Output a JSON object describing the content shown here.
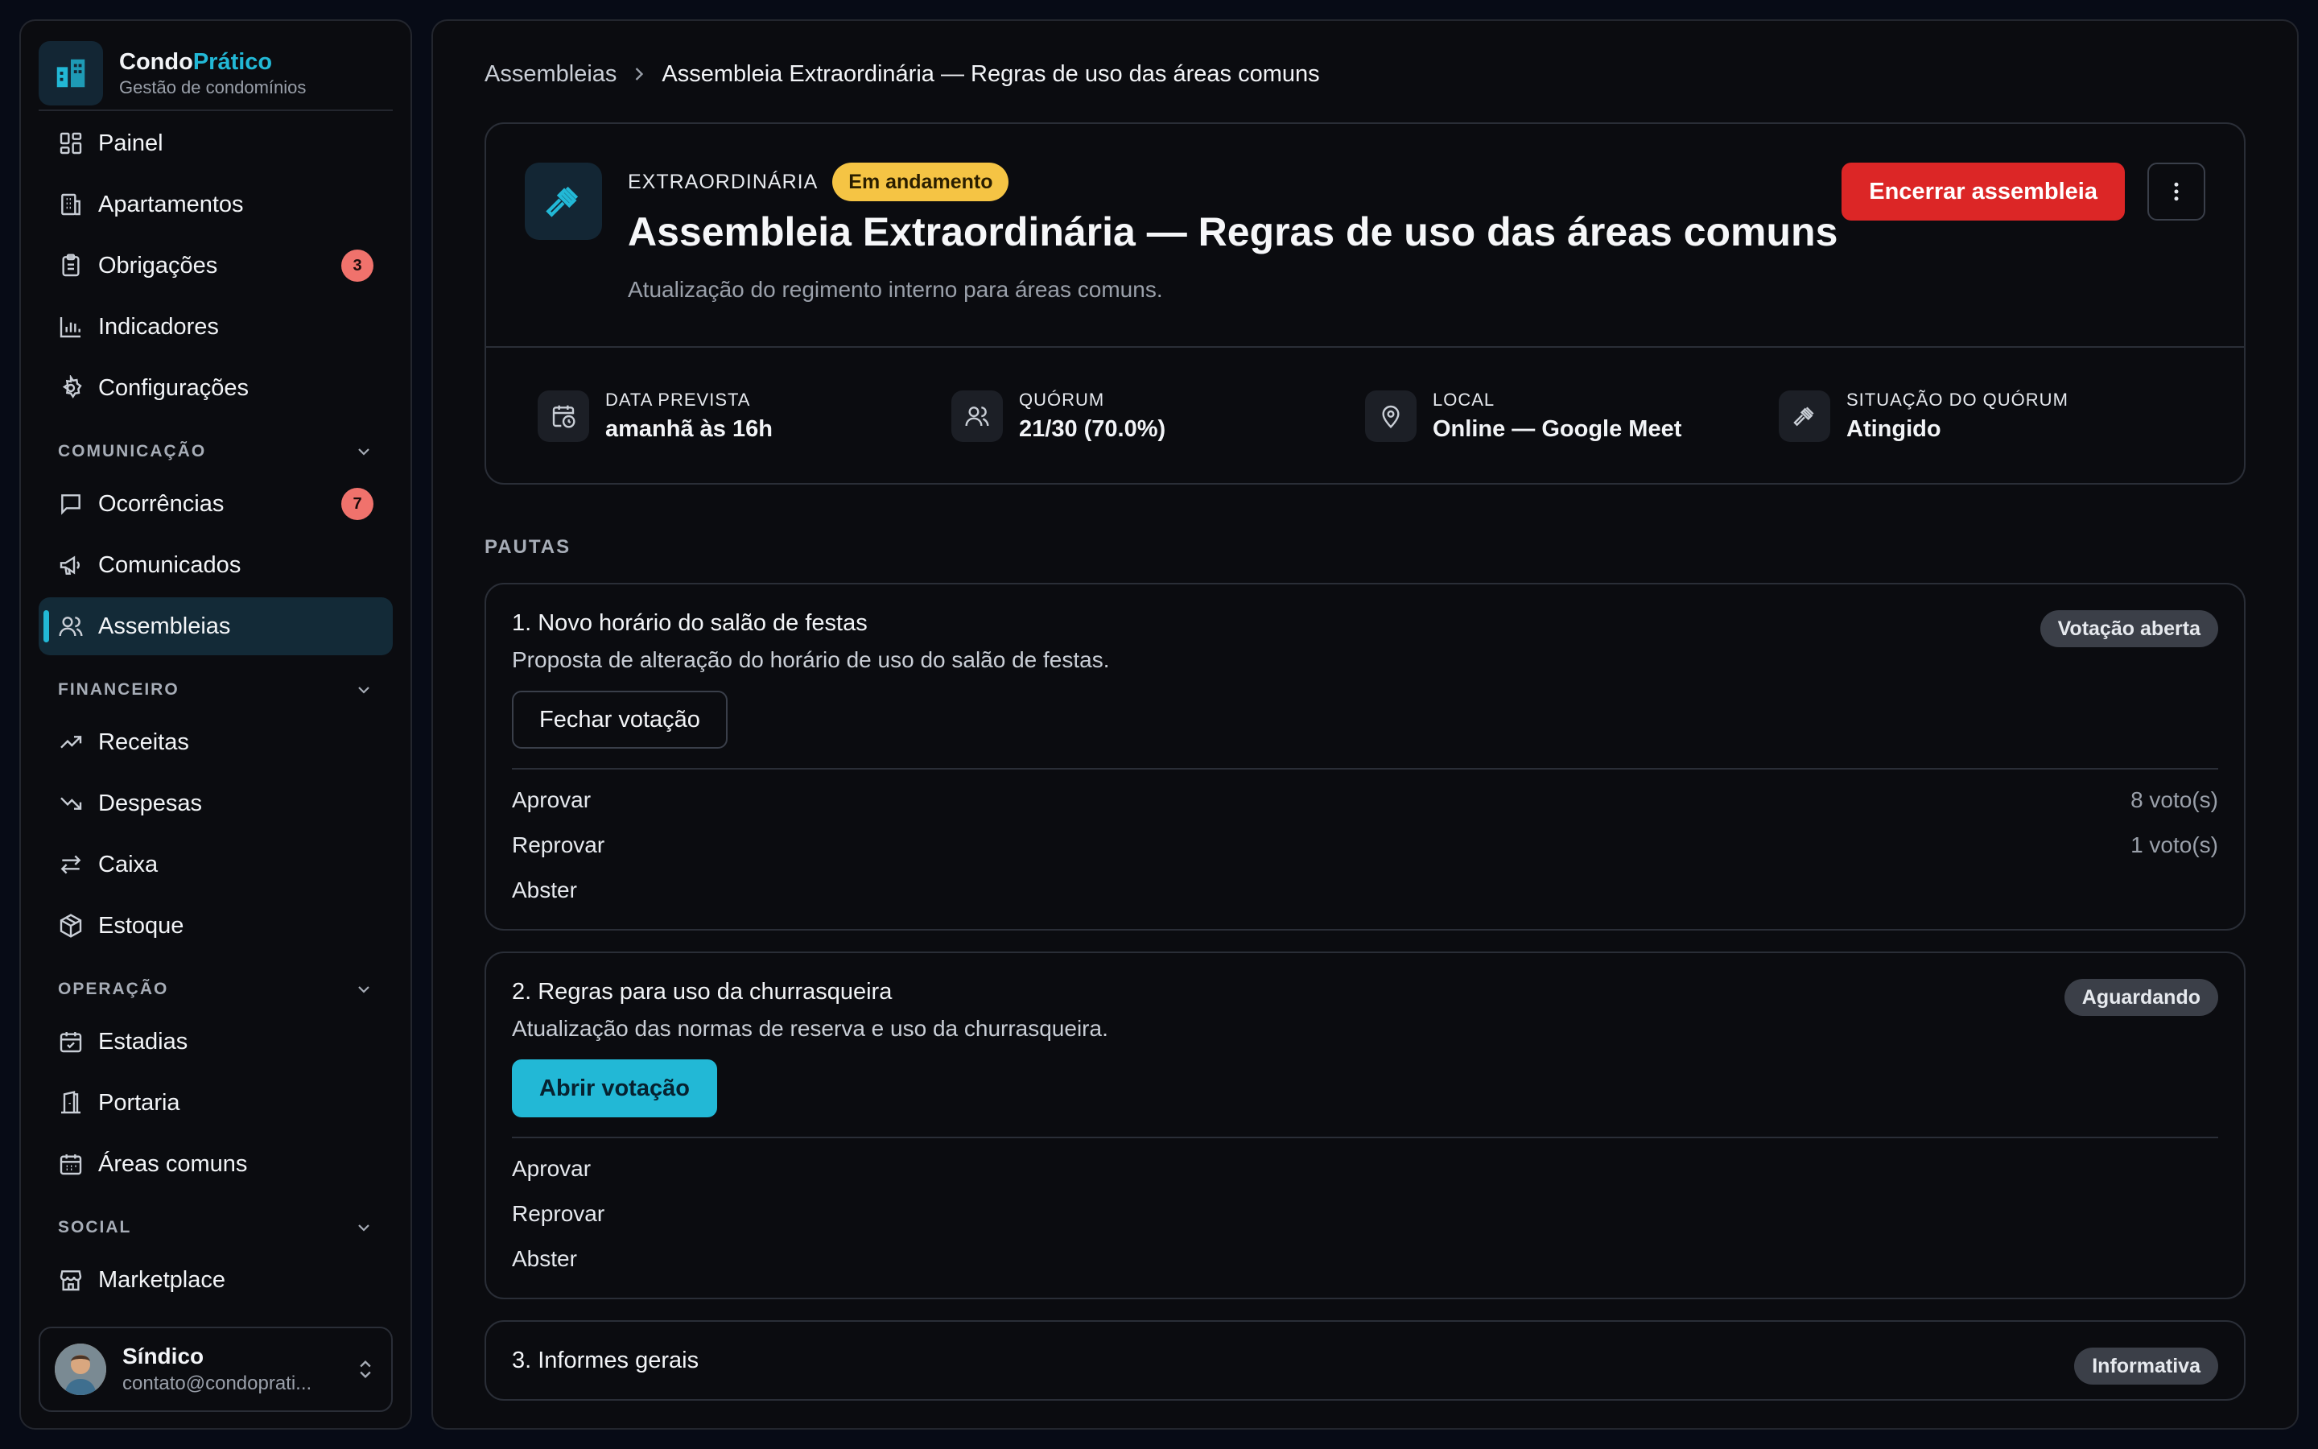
{
  "brand": {
    "name_part1": "Condo",
    "name_part2": "Prático",
    "subtitle": "Gestão de condomínios"
  },
  "nav_top": [
    {
      "label": "Painel",
      "icon": "dashboard-icon"
    },
    {
      "label": "Apartamentos",
      "icon": "building-icon"
    },
    {
      "label": "Obrigações",
      "icon": "clipboard-icon",
      "badge": "3"
    },
    {
      "label": "Indicadores",
      "icon": "bar-chart-icon"
    },
    {
      "label": "Configurações",
      "icon": "gear-icon"
    }
  ],
  "sections": {
    "comunicacao": {
      "label": "COMUNICAÇÃO",
      "items": [
        {
          "label": "Ocorrências",
          "icon": "message-icon",
          "badge": "7"
        },
        {
          "label": "Comunicados",
          "icon": "megaphone-icon"
        },
        {
          "label": "Assembleias",
          "icon": "users-icon",
          "active": true
        }
      ]
    },
    "financeiro": {
      "label": "FINANCEIRO",
      "items": [
        {
          "label": "Receitas",
          "icon": "trending-up-icon"
        },
        {
          "label": "Despesas",
          "icon": "trending-down-icon"
        },
        {
          "label": "Caixa",
          "icon": "transfer-icon"
        },
        {
          "label": "Estoque",
          "icon": "package-icon"
        }
      ]
    },
    "operacao": {
      "label": "OPERAÇÃO",
      "items": [
        {
          "label": "Estadias",
          "icon": "calendar-check-icon"
        },
        {
          "label": "Portaria",
          "icon": "door-icon"
        },
        {
          "label": "Áreas comuns",
          "icon": "calendar-grid-icon"
        }
      ]
    },
    "social": {
      "label": "SOCIAL",
      "items": [
        {
          "label": "Marketplace",
          "icon": "store-icon"
        }
      ]
    }
  },
  "user": {
    "name": "Síndico",
    "email": "contato@condoprati..."
  },
  "breadcrumb": {
    "parent": "Assembleias",
    "current": "Assembleia Extraordinária — Regras de uso das áreas comuns"
  },
  "assembly": {
    "type": "EXTRAORDINÁRIA",
    "status": "Em andamento",
    "title": "Assembleia Extraordinária — Regras de uso das áreas comuns",
    "description": "Atualização do regimento interno para áreas comuns.",
    "end_button": "Encerrar assembleia"
  },
  "stats": [
    {
      "label": "DATA PREVISTA",
      "value": "amanhã às 16h",
      "icon": "calendar-clock-icon"
    },
    {
      "label": "QUÓRUM",
      "value": "21/30 (70.0%)",
      "icon": "users-icon"
    },
    {
      "label": "LOCAL",
      "value": "Online — Google Meet",
      "icon": "map-pin-icon"
    },
    {
      "label": "SITUAÇÃO DO QUÓRUM",
      "value": "Atingido",
      "icon": "gavel-icon"
    }
  ],
  "pautas_label": "PAUTAS",
  "pautas": [
    {
      "title": "1. Novo horário do salão de festas",
      "description": "Proposta de alteração do horário de uso do salão de festas.",
      "tag": "Votação aberta",
      "action": "Fechar votação",
      "votes": [
        {
          "option": "Aprovar",
          "count": "8 voto(s)"
        },
        {
          "option": "Reprovar",
          "count": "1 voto(s)"
        },
        {
          "option": "Abster",
          "count": ""
        }
      ]
    },
    {
      "title": "2. Regras para uso da churrasqueira",
      "description": "Atualização das normas de reserva e uso da churrasqueira.",
      "tag": "Aguardando",
      "action": "Abrir votação",
      "votes": [
        {
          "option": "Aprovar",
          "count": ""
        },
        {
          "option": "Reprovar",
          "count": ""
        },
        {
          "option": "Abster",
          "count": ""
        }
      ]
    },
    {
      "title": "3. Informes gerais",
      "description": "",
      "tag": "Informativa"
    }
  ],
  "colors": {
    "accent": "#22b8d6",
    "danger": "#dc2626",
    "status_warning": "#f5c444",
    "badge": "#f0726c"
  }
}
